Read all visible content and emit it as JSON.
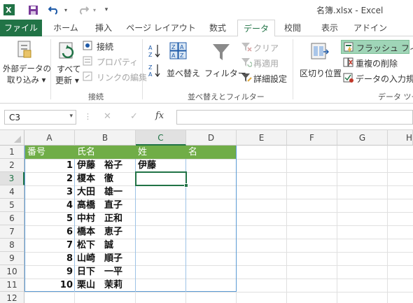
{
  "window": {
    "title": "名簿.xlsx - Excel"
  },
  "quick_access": {
    "app_icon": "excel-icon",
    "save_icon": "save-icon",
    "undo_icon": "undo-icon",
    "redo_icon": "redo-icon",
    "customize_icon": "customize-icon"
  },
  "tabs": [
    "ファイル",
    "ホーム",
    "挿入",
    "ページ レイアウト",
    "数式",
    "データ",
    "校閲",
    "表示",
    "アドイン"
  ],
  "active_tab": "データ",
  "ribbon": {
    "external_data": {
      "line1": "外部データの",
      "line2": "取り込み ▾"
    },
    "refresh_all": {
      "line1": "すべて",
      "line2": "更新 ▾"
    },
    "connections": "接続",
    "properties": "プロパティ",
    "edit_links": "リンクの編集",
    "group_connections": "接続",
    "sort": "並べ替え",
    "filter": "フィルター",
    "clear": "クリア",
    "reapply": "再適用",
    "advanced": "詳細設定",
    "group_sort_filter": "並べ替えとフィルター",
    "text_to_columns": "区切り位置",
    "flash_fill": "フラッシュ フィル",
    "remove_duplicates": "重複の削除",
    "data_validation": "データの入力規則 ▾",
    "group_data_tools": "データ ツー"
  },
  "formula_bar": {
    "name_box": "C3",
    "cancel": "✕",
    "enter": "✓",
    "fx": "fx",
    "formula": ""
  },
  "grid": {
    "columns": [
      "A",
      "B",
      "C",
      "D",
      "E",
      "F",
      "G",
      "H"
    ],
    "selected_column": "C",
    "rows": [
      "1",
      "2",
      "3",
      "4",
      "5",
      "6",
      "7",
      "8",
      "9",
      "10",
      "11",
      "12"
    ],
    "selected_row": "3",
    "headers": {
      "a": "番号",
      "b": "氏名",
      "c": "姓",
      "d": "名"
    },
    "records": [
      {
        "num": "1",
        "name": "伊藤　裕子",
        "sei": "伊藤"
      },
      {
        "num": "2",
        "name": "榎本　徹",
        "sei": ""
      },
      {
        "num": "3",
        "name": "大田　雄一",
        "sei": ""
      },
      {
        "num": "4",
        "name": "高橋　直子",
        "sei": ""
      },
      {
        "num": "5",
        "name": "中村　正和",
        "sei": ""
      },
      {
        "num": "6",
        "name": "橋本　恵子",
        "sei": ""
      },
      {
        "num": "7",
        "name": "松下　誠",
        "sei": ""
      },
      {
        "num": "8",
        "name": "山崎　順子",
        "sei": ""
      },
      {
        "num": "9",
        "name": "日下　一平",
        "sei": ""
      },
      {
        "num": "10",
        "name": "栗山　茉莉",
        "sei": ""
      }
    ]
  },
  "colors": {
    "excel_green": "#217346",
    "header_fill": "#70ad47",
    "flash_fill_highlight": "#9fd5b7",
    "table_border": "#5b9bd5"
  }
}
